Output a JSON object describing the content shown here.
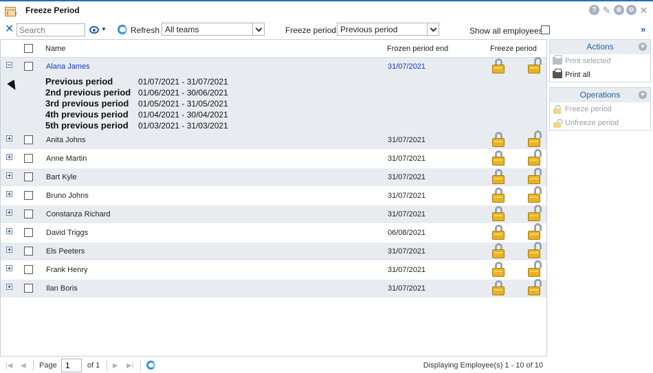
{
  "window": {
    "title": "Freeze Period",
    "controls": [
      "help-icon",
      "pin-icon",
      "maximize-icon",
      "minimize-icon",
      "close-icon"
    ],
    "controls_glyphs": [
      "?",
      "✎",
      "⊕",
      "⊖",
      "✕"
    ]
  },
  "toolbar": {
    "clear_glyph": "✕",
    "search_placeholder": "Search",
    "refresh_label": "Refresh",
    "team_select": "All teams",
    "freeze_period_label": "Freeze period:",
    "freeze_period_select": "Previous period",
    "show_all_label": "Show all employees:",
    "collapse_glyph": "»"
  },
  "grid": {
    "columns": {
      "name": "Name",
      "frozen_end": "Frozen period end",
      "freeze_period": "Freeze period"
    },
    "expanded_row": {
      "name": "Alana James",
      "frozen_end": "31/07/2021",
      "periods": [
        {
          "label": "Previous period",
          "range": "01/07/2021 - 31/07/2021"
        },
        {
          "label": "2nd previous period",
          "range": "01/06/2021 - 30/06/2021"
        },
        {
          "label": "3rd previous period",
          "range": "01/05/2021 - 31/05/2021"
        },
        {
          "label": "4th previous period",
          "range": "01/04/2021 - 30/04/2021"
        },
        {
          "label": "5th previous period",
          "range": "01/03/2021 - 31/03/2021"
        }
      ]
    },
    "rows": [
      {
        "name": "Anita Johns",
        "frozen_end": "31/07/2021"
      },
      {
        "name": "Anne Martin",
        "frozen_end": "31/07/2021"
      },
      {
        "name": "Bart Kyle",
        "frozen_end": "31/07/2021"
      },
      {
        "name": "Bruno Johns",
        "frozen_end": "31/07/2021"
      },
      {
        "name": "Constanza Richard",
        "frozen_end": "31/07/2021"
      },
      {
        "name": "David Triggs",
        "frozen_end": "06/08/2021"
      },
      {
        "name": "Els Peeters",
        "frozen_end": "31/07/2021"
      },
      {
        "name": "Frank Henry",
        "frozen_end": "31/07/2021"
      },
      {
        "name": "Ilan Boris",
        "frozen_end": "31/07/2021"
      }
    ]
  },
  "actions": {
    "title": "Actions",
    "items": [
      {
        "label": "Print selected",
        "enabled": false
      },
      {
        "label": "Print all",
        "enabled": true
      }
    ]
  },
  "operations": {
    "title": "Operations",
    "items": [
      {
        "label": "Freeze period",
        "enabled": false
      },
      {
        "label": "Unfreeze period",
        "enabled": false
      }
    ]
  },
  "paging": {
    "page_label": "Page",
    "page_value": "1",
    "of_label": "of 1",
    "display_text": "Displaying Employee(s) 1 - 10 of 10",
    "nav_glyphs": {
      "first": "|◀",
      "prev": "◀",
      "next": "▶",
      "last": "▶|"
    }
  },
  "colors": {
    "accent": "#1f5f9f",
    "row_shade": "#e8ecf1",
    "link": "#1536c6",
    "lock": "#e8b323"
  }
}
